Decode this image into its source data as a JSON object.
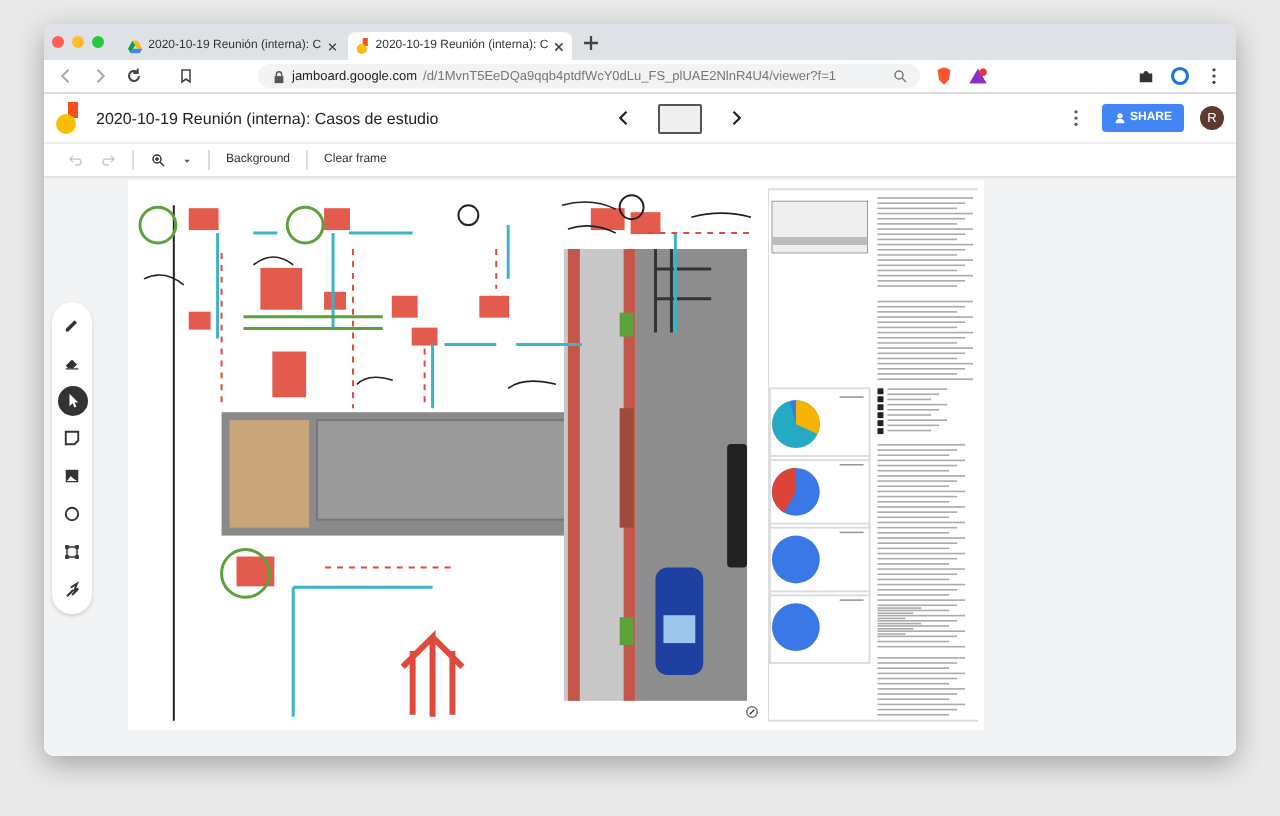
{
  "browser": {
    "tabs": [
      {
        "kind": "drive",
        "title": "2020-10-19 Reunión (interna): C",
        "selected": false
      },
      {
        "kind": "jamboard",
        "title": "2020-10-19 Reunión (interna): C",
        "selected": true
      }
    ],
    "url_host": "jamboard.google.com",
    "url_path": "/d/1MvnT5EeDQa9qqb4ptdfWcY0dLu_FS_plUAE2NlnR4U4/viewer?f=1"
  },
  "app": {
    "title": "2020-10-19 Reunión (interna): Casos de estudio",
    "share_label": "SHARE",
    "avatar_initial": "R"
  },
  "toolbar": {
    "undo_disabled": true,
    "redo_disabled": true,
    "actions": [
      "Background",
      "Clear frame"
    ]
  },
  "tools": [
    {
      "kind": "pen",
      "selected": false
    },
    {
      "kind": "eraser",
      "selected": false
    },
    {
      "kind": "select",
      "selected": true
    },
    {
      "kind": "note",
      "selected": false
    },
    {
      "kind": "image",
      "selected": false
    },
    {
      "kind": "circle",
      "selected": false
    },
    {
      "kind": "textbox",
      "selected": false
    },
    {
      "kind": "laser",
      "selected": false
    }
  ]
}
